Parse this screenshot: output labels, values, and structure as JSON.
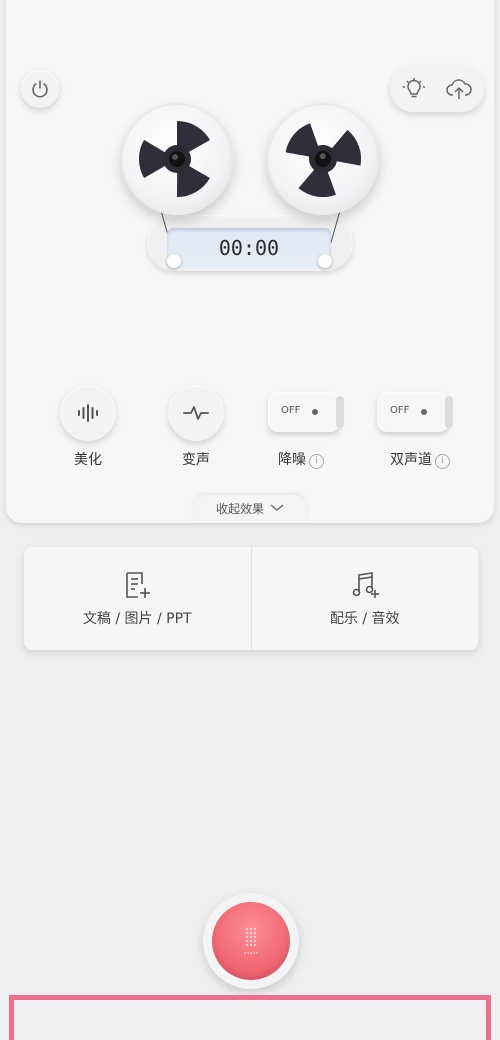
{
  "header": {
    "power_icon": "power-icon",
    "light_icon": "lightbulb-icon",
    "upload_icon": "cloud-upload-icon"
  },
  "recorder": {
    "timer": "00:00"
  },
  "effects": {
    "items": [
      {
        "label": "美化",
        "icon": "waveform-icon"
      },
      {
        "label": "变声",
        "icon": "pulse-icon"
      },
      {
        "label": "降噪",
        "state": "OFF",
        "info": "i"
      },
      {
        "label": "双声道",
        "state": "OFF",
        "info": "i"
      }
    ],
    "collapse_label": "收起效果"
  },
  "tools": {
    "docs_label": "文稿 / 图片 / PPT",
    "music_label": "配乐 / 音效"
  },
  "colors": {
    "record": "#f06873",
    "highlight_border": "#ec6f8e"
  }
}
